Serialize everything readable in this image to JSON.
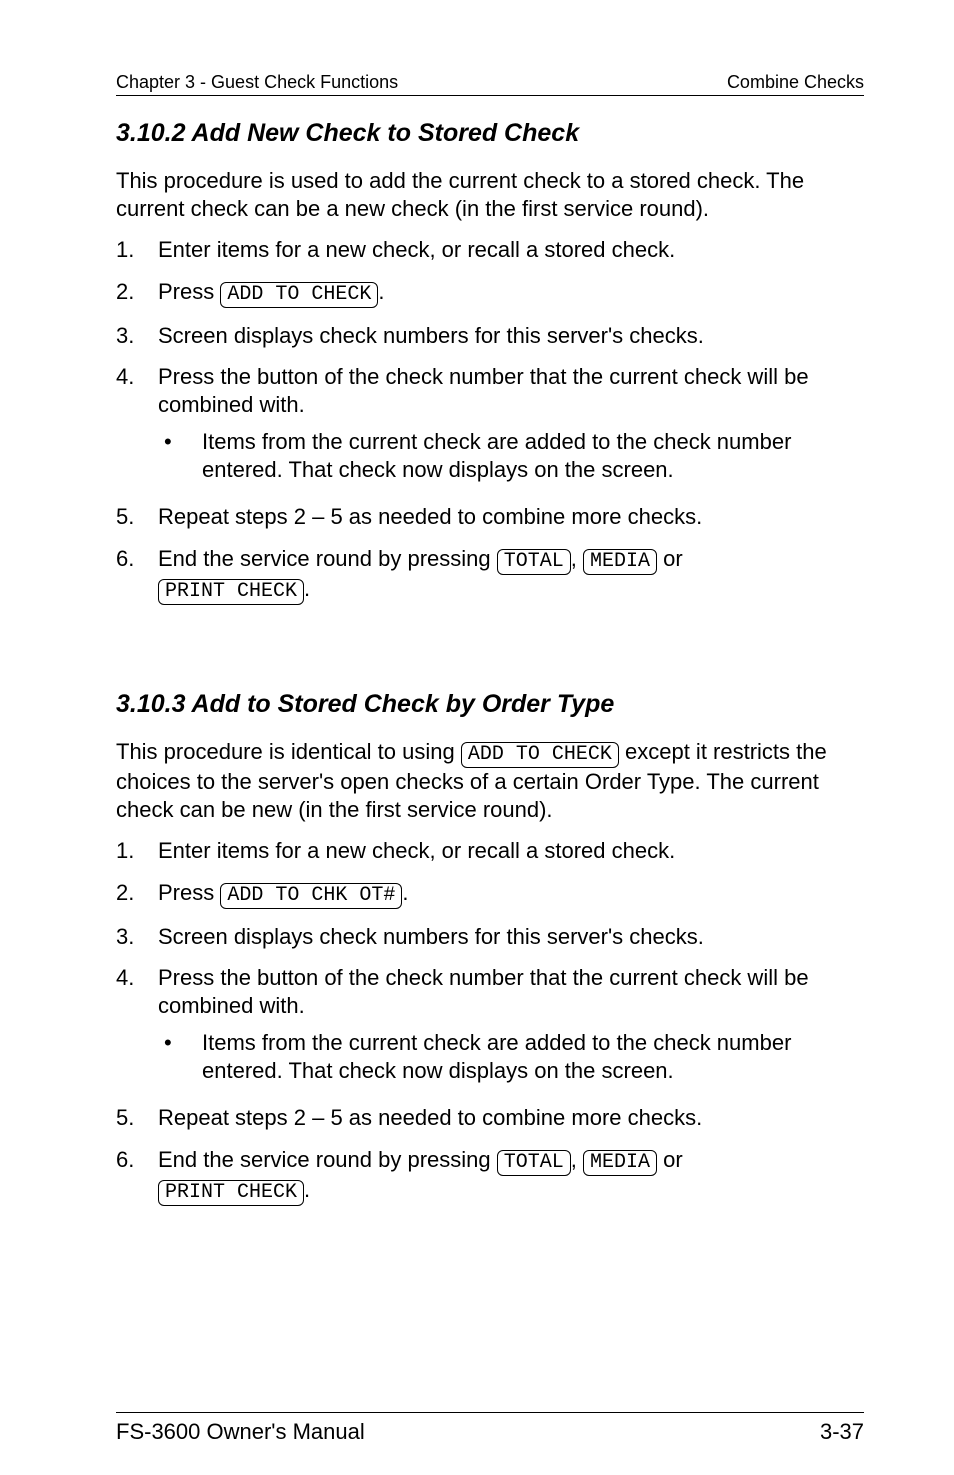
{
  "header": {
    "left": "Chapter 3 - Guest Check Functions",
    "right": "Combine Checks"
  },
  "section_a": {
    "title": "3.10.2  Add New Check to Stored Check",
    "intro": "This procedure is used to add the current check to a stored check.  The current check can be a new check (in the first service round).",
    "steps": {
      "s1": {
        "num": "1.",
        "text": "Enter items for a new check, or recall a stored check."
      },
      "s2": {
        "num": "2.",
        "prefix": "Press ",
        "key": "ADD TO CHECK",
        "suffix": "."
      },
      "s3": {
        "num": "3.",
        "text": "Screen displays check numbers for this server's checks."
      },
      "s4": {
        "num": "4.",
        "text": "Press the button of the check number that the current check will be combined with.",
        "bullet": "Items from the current check are added to the check number entered.  That check now displays on the screen."
      },
      "s5": {
        "num": "5.",
        "text": "Repeat steps 2 – 5 as needed to combine more checks."
      },
      "s6": {
        "num": "6.",
        "prefix": "End the service round by pressing ",
        "key1": "TOTAL",
        "sep1": ", ",
        "key2": "MEDIA",
        "sep2": " or ",
        "key3": "PRINT CHECK",
        "suffix": "."
      }
    }
  },
  "section_b": {
    "title": "3.10.3  Add to Stored Check by Order Type",
    "intro_prefix": "This procedure is identical to using ",
    "intro_key": "ADD TO CHECK",
    "intro_suffix": " except it restricts the choices to the server's open checks of a certain Order Type.  The current check can be new (in the first service round).",
    "steps": {
      "s1": {
        "num": "1.",
        "text": "Enter items for a new check, or recall a stored check."
      },
      "s2": {
        "num": "2.",
        "prefix": "Press ",
        "key": "ADD TO CHK OT#",
        "suffix": "."
      },
      "s3": {
        "num": "3.",
        "text": "Screen displays check numbers for this server's checks."
      },
      "s4": {
        "num": "4.",
        "text": "Press the button of the check number that the current check will be combined with.",
        "bullet": "Items from the current check are added to the check number entered.  That check now displays on the screen."
      },
      "s5": {
        "num": "5.",
        "text": "Repeat steps 2 – 5 as needed to combine more checks."
      },
      "s6": {
        "num": "6.",
        "prefix": "End the service round by pressing ",
        "key1": "TOTAL",
        "sep1": ", ",
        "key2": "MEDIA",
        "sep2": " or ",
        "key3": "PRINT CHECK",
        "suffix": "."
      }
    }
  },
  "footer": {
    "left": "FS-3600 Owner's Manual",
    "right": "3-37"
  },
  "bullet_glyph": "•"
}
